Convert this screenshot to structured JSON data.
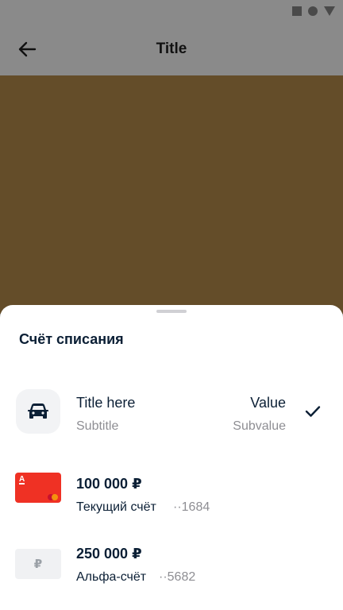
{
  "app_bar": {
    "title": "Title",
    "back_icon": "arrow-left-icon"
  },
  "sheet": {
    "title": "Счёт списания",
    "items": [
      {
        "icon": "car-icon",
        "title": "Title here",
        "subtitle": "Subtitle",
        "value": "Value",
        "subvalue": "Subvalue",
        "selected": true
      },
      {
        "icon": "alfa-card-icon",
        "amount": "100 000 ₽",
        "name": "Текущий счёт",
        "number": "··1684"
      },
      {
        "icon": "ruble-icon",
        "icon_text": "₽",
        "amount": "250 000 ₽",
        "name": "Альфа-счёт",
        "number": "··5682"
      }
    ]
  },
  "colors": {
    "content_bg": "#644d29",
    "card_red": "#ef3124",
    "scrim": "#8a8a8a"
  }
}
